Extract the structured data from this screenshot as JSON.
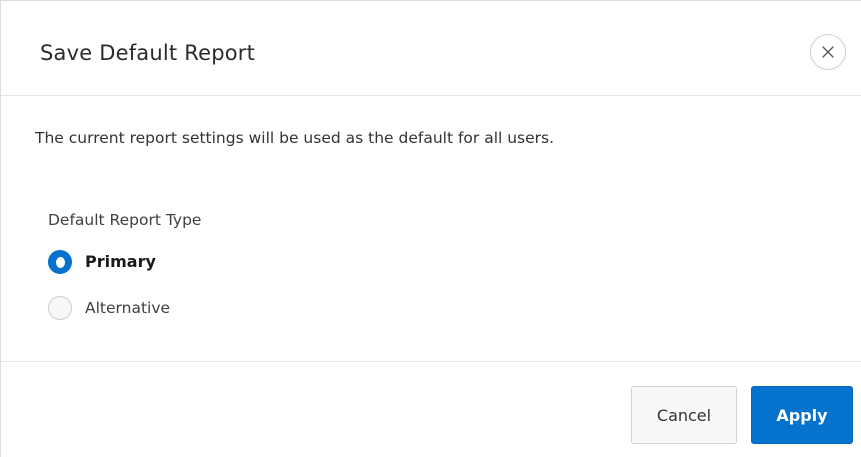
{
  "dialog": {
    "title": "Save Default Report",
    "close_icon": "close-icon",
    "message": "The current report settings will be used as the default for all users."
  },
  "report_type": {
    "label": "Default Report Type",
    "options": [
      {
        "label": "Primary",
        "checked": true
      },
      {
        "label": "Alternative",
        "checked": false
      }
    ]
  },
  "footer": {
    "cancel_label": "Cancel",
    "apply_label": "Apply"
  },
  "colors": {
    "accent": "#0572ce",
    "border": "#e6e6e6",
    "text": "#262626"
  }
}
